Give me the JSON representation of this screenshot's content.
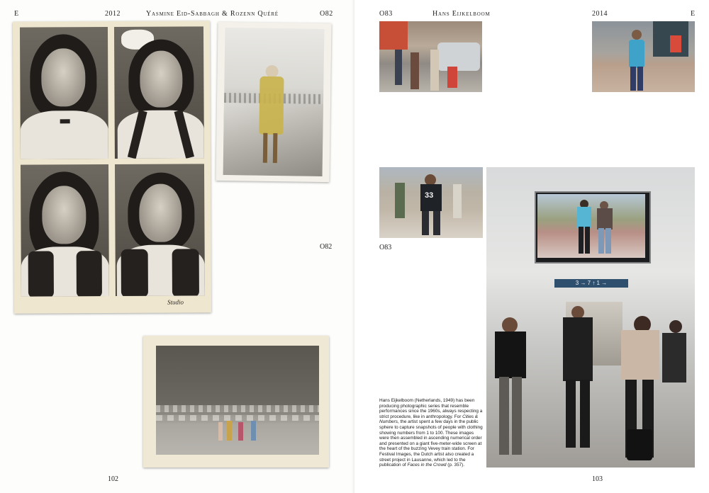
{
  "left_page": {
    "section_letter": "E",
    "year": "2012",
    "artists": "Yasmine Eid-Sabbagh & Rozenn Quéré",
    "plate_top": "O82",
    "plate_mid": "O82",
    "page_number": "102",
    "stamp_text": "Studio"
  },
  "right_page": {
    "plate_top_left": "O83",
    "artist": "Hans Eijkelboom",
    "year": "2014",
    "section_letter": "E",
    "plate_mid": "O83",
    "page_number": "103",
    "photo_labels": {
      "mid_left_jersey": "33",
      "station_sign": "3 → 7   ↑   1 →"
    },
    "caption_parts": {
      "p1": "Hans Eijkelboom (Netherlands, 1949) has been producing photographic series that resemble performances since the 1960s, always respecting a strict procedure, like in anthropology. For ",
      "p1_italic": "Cities & Numbers",
      "p2": ", the artist spent a few days in the public sphere to capture snapshots of people with clothing showing numbers from 1 to 100. These images were then assembled in ascending numerical order and presented on a giant five-meter-wide screen at the heart of the buzzing Vevey train station. For Festival Images, the Dutch artist also created a street project in Lausanne, which led to the publication of ",
      "p2_italic": "Faces in the Crowd",
      "p3": " (p. 357)."
    }
  },
  "colors": {
    "paper": "#efe6cf",
    "sepia_dark": "#4c4740",
    "text": "#1e1e1e"
  }
}
